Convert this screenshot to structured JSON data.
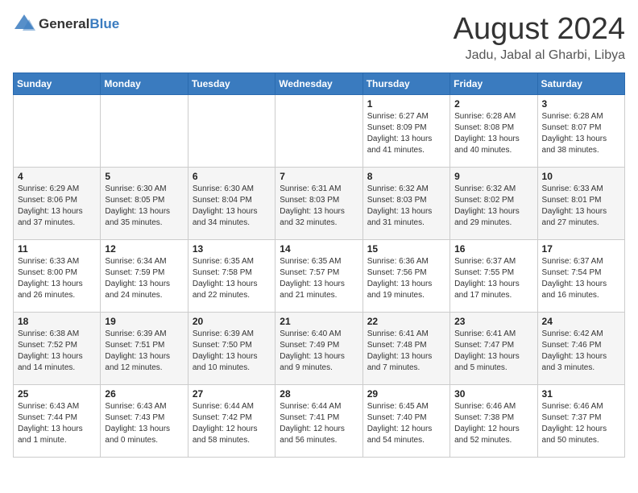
{
  "logo": {
    "general": "General",
    "blue": "Blue"
  },
  "title": "August 2024",
  "subtitle": "Jadu, Jabal al Gharbi, Libya",
  "days_header": [
    "Sunday",
    "Monday",
    "Tuesday",
    "Wednesday",
    "Thursday",
    "Friday",
    "Saturday"
  ],
  "weeks": [
    [
      {
        "day": "",
        "info": ""
      },
      {
        "day": "",
        "info": ""
      },
      {
        "day": "",
        "info": ""
      },
      {
        "day": "",
        "info": ""
      },
      {
        "day": "1",
        "info": "Sunrise: 6:27 AM\nSunset: 8:09 PM\nDaylight: 13 hours\nand 41 minutes."
      },
      {
        "day": "2",
        "info": "Sunrise: 6:28 AM\nSunset: 8:08 PM\nDaylight: 13 hours\nand 40 minutes."
      },
      {
        "day": "3",
        "info": "Sunrise: 6:28 AM\nSunset: 8:07 PM\nDaylight: 13 hours\nand 38 minutes."
      }
    ],
    [
      {
        "day": "4",
        "info": "Sunrise: 6:29 AM\nSunset: 8:06 PM\nDaylight: 13 hours\nand 37 minutes."
      },
      {
        "day": "5",
        "info": "Sunrise: 6:30 AM\nSunset: 8:05 PM\nDaylight: 13 hours\nand 35 minutes."
      },
      {
        "day": "6",
        "info": "Sunrise: 6:30 AM\nSunset: 8:04 PM\nDaylight: 13 hours\nand 34 minutes."
      },
      {
        "day": "7",
        "info": "Sunrise: 6:31 AM\nSunset: 8:03 PM\nDaylight: 13 hours\nand 32 minutes."
      },
      {
        "day": "8",
        "info": "Sunrise: 6:32 AM\nSunset: 8:03 PM\nDaylight: 13 hours\nand 31 minutes."
      },
      {
        "day": "9",
        "info": "Sunrise: 6:32 AM\nSunset: 8:02 PM\nDaylight: 13 hours\nand 29 minutes."
      },
      {
        "day": "10",
        "info": "Sunrise: 6:33 AM\nSunset: 8:01 PM\nDaylight: 13 hours\nand 27 minutes."
      }
    ],
    [
      {
        "day": "11",
        "info": "Sunrise: 6:33 AM\nSunset: 8:00 PM\nDaylight: 13 hours\nand 26 minutes."
      },
      {
        "day": "12",
        "info": "Sunrise: 6:34 AM\nSunset: 7:59 PM\nDaylight: 13 hours\nand 24 minutes."
      },
      {
        "day": "13",
        "info": "Sunrise: 6:35 AM\nSunset: 7:58 PM\nDaylight: 13 hours\nand 22 minutes."
      },
      {
        "day": "14",
        "info": "Sunrise: 6:35 AM\nSunset: 7:57 PM\nDaylight: 13 hours\nand 21 minutes."
      },
      {
        "day": "15",
        "info": "Sunrise: 6:36 AM\nSunset: 7:56 PM\nDaylight: 13 hours\nand 19 minutes."
      },
      {
        "day": "16",
        "info": "Sunrise: 6:37 AM\nSunset: 7:55 PM\nDaylight: 13 hours\nand 17 minutes."
      },
      {
        "day": "17",
        "info": "Sunrise: 6:37 AM\nSunset: 7:54 PM\nDaylight: 13 hours\nand 16 minutes."
      }
    ],
    [
      {
        "day": "18",
        "info": "Sunrise: 6:38 AM\nSunset: 7:52 PM\nDaylight: 13 hours\nand 14 minutes."
      },
      {
        "day": "19",
        "info": "Sunrise: 6:39 AM\nSunset: 7:51 PM\nDaylight: 13 hours\nand 12 minutes."
      },
      {
        "day": "20",
        "info": "Sunrise: 6:39 AM\nSunset: 7:50 PM\nDaylight: 13 hours\nand 10 minutes."
      },
      {
        "day": "21",
        "info": "Sunrise: 6:40 AM\nSunset: 7:49 PM\nDaylight: 13 hours\nand 9 minutes."
      },
      {
        "day": "22",
        "info": "Sunrise: 6:41 AM\nSunset: 7:48 PM\nDaylight: 13 hours\nand 7 minutes."
      },
      {
        "day": "23",
        "info": "Sunrise: 6:41 AM\nSunset: 7:47 PM\nDaylight: 13 hours\nand 5 minutes."
      },
      {
        "day": "24",
        "info": "Sunrise: 6:42 AM\nSunset: 7:46 PM\nDaylight: 13 hours\nand 3 minutes."
      }
    ],
    [
      {
        "day": "25",
        "info": "Sunrise: 6:43 AM\nSunset: 7:44 PM\nDaylight: 13 hours\nand 1 minute."
      },
      {
        "day": "26",
        "info": "Sunrise: 6:43 AM\nSunset: 7:43 PM\nDaylight: 13 hours\nand 0 minutes."
      },
      {
        "day": "27",
        "info": "Sunrise: 6:44 AM\nSunset: 7:42 PM\nDaylight: 12 hours\nand 58 minutes."
      },
      {
        "day": "28",
        "info": "Sunrise: 6:44 AM\nSunset: 7:41 PM\nDaylight: 12 hours\nand 56 minutes."
      },
      {
        "day": "29",
        "info": "Sunrise: 6:45 AM\nSunset: 7:40 PM\nDaylight: 12 hours\nand 54 minutes."
      },
      {
        "day": "30",
        "info": "Sunrise: 6:46 AM\nSunset: 7:38 PM\nDaylight: 12 hours\nand 52 minutes."
      },
      {
        "day": "31",
        "info": "Sunrise: 6:46 AM\nSunset: 7:37 PM\nDaylight: 12 hours\nand 50 minutes."
      }
    ]
  ]
}
